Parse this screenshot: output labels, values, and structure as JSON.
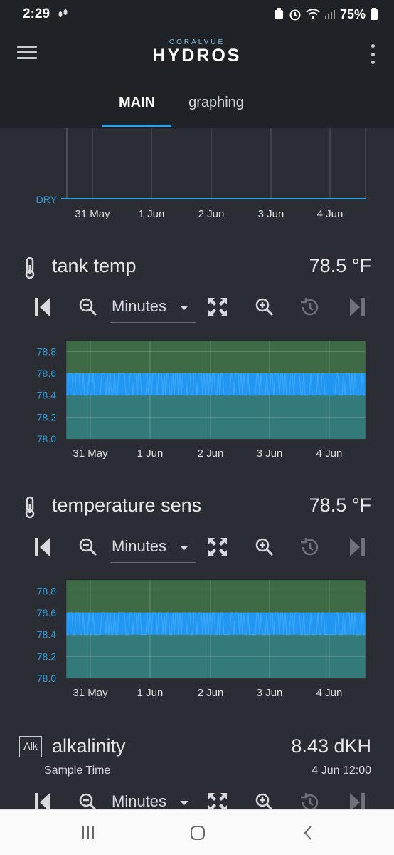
{
  "status_bar": {
    "time": "2:29",
    "battery": "75%",
    "icons": [
      "steps-icon",
      "recycle-icon",
      "alarm-icon",
      "wifi-icon",
      "signal-icon",
      "battery-icon"
    ]
  },
  "header": {
    "logo_sub": "CORALVUE",
    "logo_main": "HYDROS",
    "tabs": [
      {
        "label": "MAIN",
        "active": true
      },
      {
        "label": "graphing",
        "active": false
      }
    ],
    "accent_color": "#2e9fe0"
  },
  "top_chart": {
    "y_tick": "DRY",
    "x_ticks": [
      "31 May",
      "1 Jun",
      "2 Jun",
      "3 Jun",
      "4 Jun"
    ]
  },
  "sections": [
    {
      "name": "tank temp",
      "value": "78.5 °F",
      "icon": "thermometer-icon",
      "range": "Minutes",
      "chart": {
        "y_ticks": [
          "78.8",
          "78.6",
          "78.4",
          "78.2",
          "78.0"
        ],
        "x_ticks": [
          "31 May",
          "1 Jun",
          "2 Jun",
          "3 Jun",
          "4 Jun"
        ]
      }
    },
    {
      "name": "temperature sens",
      "value": "78.5 °F",
      "icon": "thermometer-icon",
      "range": "Minutes",
      "chart": {
        "y_ticks": [
          "78.8",
          "78.6",
          "78.4",
          "78.2",
          "78.0"
        ],
        "x_ticks": [
          "31 May",
          "1 Jun",
          "2 Jun",
          "3 Jun",
          "4 Jun"
        ]
      }
    },
    {
      "name": "alkalinity",
      "value": "8.43 dKH",
      "icon_label": "Alk",
      "sample_label": "Sample Time",
      "sample_time": "4 Jun 12:00",
      "range": "Minutes"
    }
  ],
  "chart_data": [
    {
      "type": "area",
      "ylabel": "",
      "y_tick_labels": [
        "78.8",
        "78.6",
        "78.4",
        "78.2",
        "78.0"
      ],
      "x_tick_labels": [
        "31 May",
        "1 Jun",
        "2 Jun",
        "3 Jun",
        "4 Jun"
      ],
      "ylim": [
        78.0,
        78.9
      ],
      "series": [
        {
          "values_min": 78.4,
          "values_max": 78.6
        }
      ],
      "band_colors": {
        "upper": "#3e6b45",
        "lower": "#357a7a",
        "line": "#2196f3"
      }
    },
    {
      "type": "area",
      "ylabel": "",
      "y_tick_labels": [
        "78.8",
        "78.6",
        "78.4",
        "78.2",
        "78.0"
      ],
      "x_tick_labels": [
        "31 May",
        "1 Jun",
        "2 Jun",
        "3 Jun",
        "4 Jun"
      ],
      "ylim": [
        78.0,
        78.9
      ],
      "series": [
        {
          "values_min": 78.4,
          "values_max": 78.6
        }
      ],
      "band_colors": {
        "upper": "#3e6b45",
        "lower": "#357a7a",
        "line": "#2196f3"
      }
    }
  ]
}
